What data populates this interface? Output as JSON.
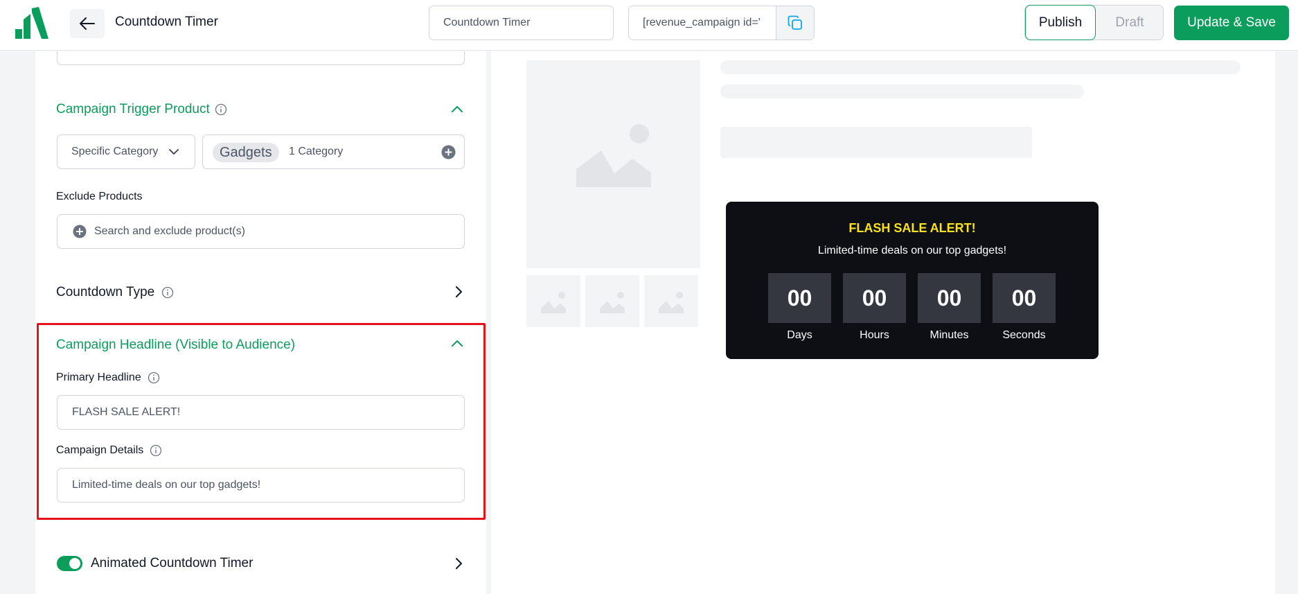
{
  "header": {
    "title": "Countdown Timer",
    "campaign_name_value": "Countdown Timer",
    "shortcode_value": "[revenue_campaign id='",
    "publish_label": "Publish",
    "draft_label": "Draft",
    "save_label": "Update & Save"
  },
  "settings": {
    "trigger_product": {
      "title": "Campaign Trigger Product",
      "selector_value": "Specific Category",
      "selected_chip": "Gadgets",
      "count_text": "1 Category"
    },
    "exclude_products": {
      "label": "Exclude Products",
      "placeholder": "Search and exclude product(s)"
    },
    "countdown_type": {
      "title": "Countdown Type"
    },
    "campaign_headline": {
      "title": "Campaign Headline (Visible to Audience)",
      "primary_label": "Primary Headline",
      "primary_value": "FLASH SALE ALERT!",
      "details_label": "Campaign Details",
      "details_value": "Limited-time deals on our top gadgets!"
    },
    "animated_timer": {
      "title": "Animated Countdown Timer",
      "enabled": true
    }
  },
  "preview": {
    "headline": "FLASH SALE ALERT!",
    "details": "Limited-time deals on our top gadgets!",
    "units": [
      {
        "value": "00",
        "label": "Days"
      },
      {
        "value": "00",
        "label": "Hours"
      },
      {
        "value": "00",
        "label": "Minutes"
      },
      {
        "value": "00",
        "label": "Seconds"
      }
    ]
  },
  "colors": {
    "brand_green": "#0a9d5c",
    "highlight_red": "#e8121a",
    "countdown_bg": "#0d0f14",
    "headline_yellow": "#f9e21b"
  }
}
